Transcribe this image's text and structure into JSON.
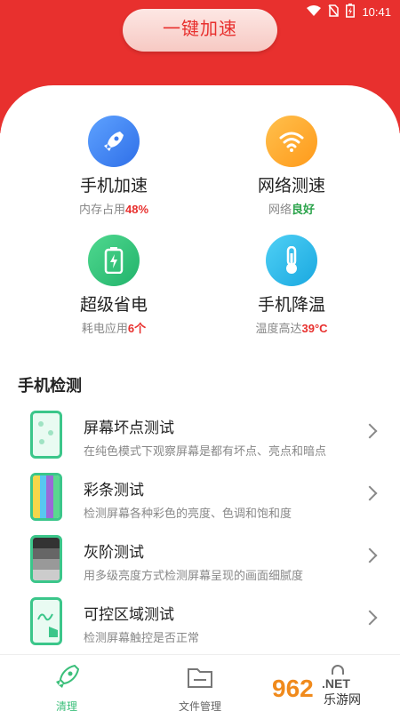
{
  "status": {
    "time": "10:41"
  },
  "header": {
    "boost_label": "一键加速"
  },
  "tools": [
    {
      "title": "手机加速",
      "sub_prefix": "内存占用",
      "sub_value": "48%"
    },
    {
      "title": "网络测速",
      "sub_prefix": "网络",
      "sub_value": "良好"
    },
    {
      "title": "超级省电",
      "sub_prefix": "耗电应用",
      "sub_value": "6个"
    },
    {
      "title": "手机降温",
      "sub_prefix": "温度高达",
      "sub_value": "39°C"
    }
  ],
  "section": {
    "title": "手机检测"
  },
  "checks": [
    {
      "title": "屏幕坏点测试",
      "desc": "在纯色模式下观察屏幕是都有坏点、亮点和暗点"
    },
    {
      "title": "彩条测试",
      "desc": "检测屏幕各种彩色的亮度、色调和饱和度"
    },
    {
      "title": "灰阶测试",
      "desc": "用多级亮度方式检测屏幕呈现的画面细腻度"
    },
    {
      "title": "可控区域测试",
      "desc": "检测屏幕触控是否正常"
    }
  ],
  "nav": [
    {
      "label": "清理"
    },
    {
      "label": "文件管理"
    }
  ],
  "watermark": {
    "brand": "962",
    "suffix": ".NET",
    "sub": "乐游网"
  },
  "colors": {
    "primary_red": "#e8302e",
    "accent_green": "#3bbf7a"
  }
}
